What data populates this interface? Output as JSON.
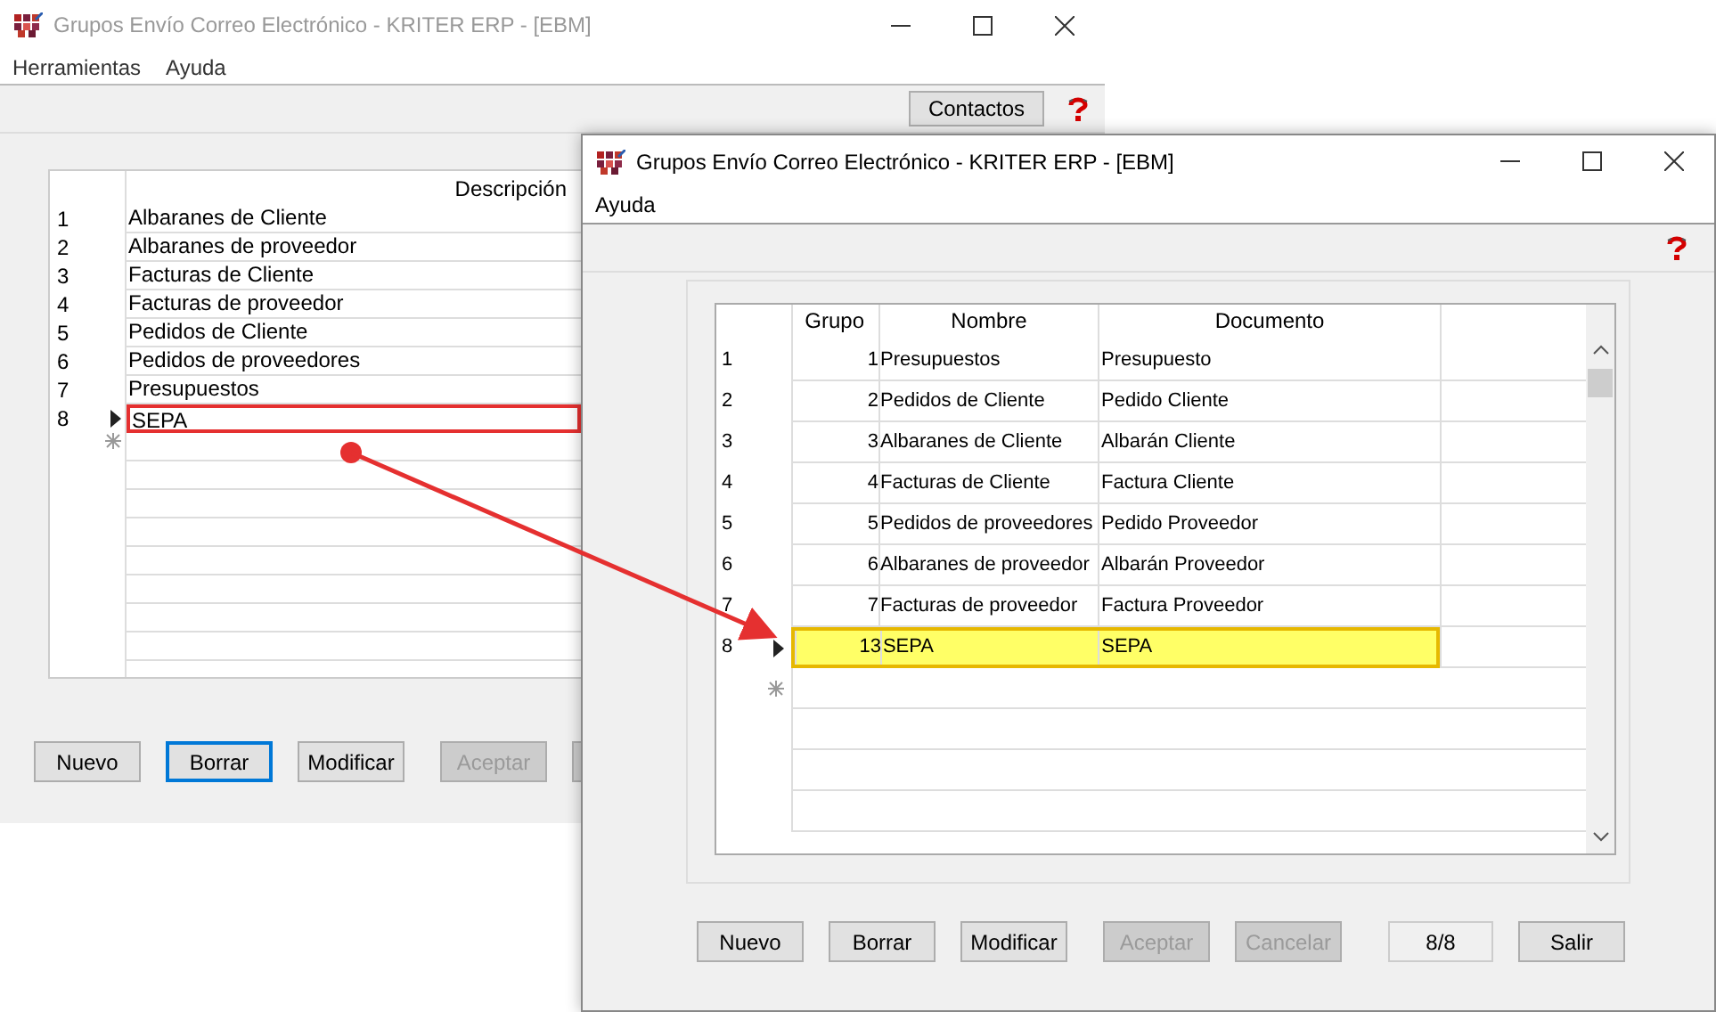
{
  "back_window": {
    "title": "Grupos Envío Correo Electrónico - KRITER ERP - [EBM]",
    "menu": [
      "Herramientas",
      "Ayuda"
    ],
    "toolbar_button": "Contactos",
    "grid": {
      "columns": [
        "Descripción"
      ],
      "rows": [
        {
          "number": "1",
          "descripcion": "Albaranes de Cliente",
          "current": false,
          "highlighted": false
        },
        {
          "number": "2",
          "descripcion": "Albaranes de proveedor",
          "current": false,
          "highlighted": false
        },
        {
          "number": "3",
          "descripcion": "Facturas de Cliente",
          "current": false,
          "highlighted": false
        },
        {
          "number": "4",
          "descripcion": "Facturas de proveedor",
          "current": false,
          "highlighted": false
        },
        {
          "number": "5",
          "descripcion": "Pedidos de Cliente",
          "current": false,
          "highlighted": false
        },
        {
          "number": "6",
          "descripcion": "Pedidos de proveedores",
          "current": false,
          "highlighted": false
        },
        {
          "number": "7",
          "descripcion": "Presupuestos",
          "current": false,
          "highlighted": false
        },
        {
          "number": "8",
          "descripcion": "SEPA",
          "current": true,
          "highlighted": true
        }
      ]
    },
    "buttons": [
      {
        "label": "Nuevo",
        "disabled": false,
        "focused": false
      },
      {
        "label": "Borrar",
        "disabled": false,
        "focused": true
      },
      {
        "label": "Modificar",
        "disabled": false,
        "focused": false
      },
      {
        "label": "Aceptar",
        "disabled": true,
        "focused": false
      }
    ]
  },
  "front_window": {
    "title": "Grupos Envío Correo Electrónico - KRITER ERP - [EBM]",
    "menu": [
      "Ayuda"
    ],
    "grid": {
      "columns": [
        "Grupo",
        "Nombre",
        "Documento"
      ],
      "rows": [
        {
          "number": "1",
          "grupo": "1",
          "nombre": "Presupuestos",
          "documento": "Presupuesto",
          "selected": false
        },
        {
          "number": "2",
          "grupo": "2",
          "nombre": "Pedidos de Cliente",
          "documento": "Pedido Cliente",
          "selected": false
        },
        {
          "number": "3",
          "grupo": "3",
          "nombre": "Albaranes de Cliente",
          "documento": "Albarán Cliente",
          "selected": false
        },
        {
          "number": "4",
          "grupo": "4",
          "nombre": "Facturas de Cliente",
          "documento": "Factura Cliente",
          "selected": false
        },
        {
          "number": "5",
          "grupo": "5",
          "nombre": "Pedidos de proveedores",
          "documento": "Pedido Proveedor",
          "selected": false
        },
        {
          "number": "6",
          "grupo": "6",
          "nombre": "Albaranes de proveedor",
          "documento": "Albarán Proveedor",
          "selected": false
        },
        {
          "number": "7",
          "grupo": "7",
          "nombre": "Facturas de proveedor",
          "documento": "Factura Proveedor",
          "selected": false
        },
        {
          "number": "8",
          "grupo": "13",
          "nombre": "SEPA",
          "documento": "SEPA",
          "selected": true
        }
      ]
    },
    "buttons": [
      {
        "label": "Nuevo",
        "disabled": false
      },
      {
        "label": "Borrar",
        "disabled": false
      },
      {
        "label": "Modificar",
        "disabled": false
      },
      {
        "label": "Aceptar",
        "disabled": true
      },
      {
        "label": "Cancelar",
        "disabled": true
      }
    ],
    "record_counter": "8/8",
    "exit_button": "Salir"
  }
}
